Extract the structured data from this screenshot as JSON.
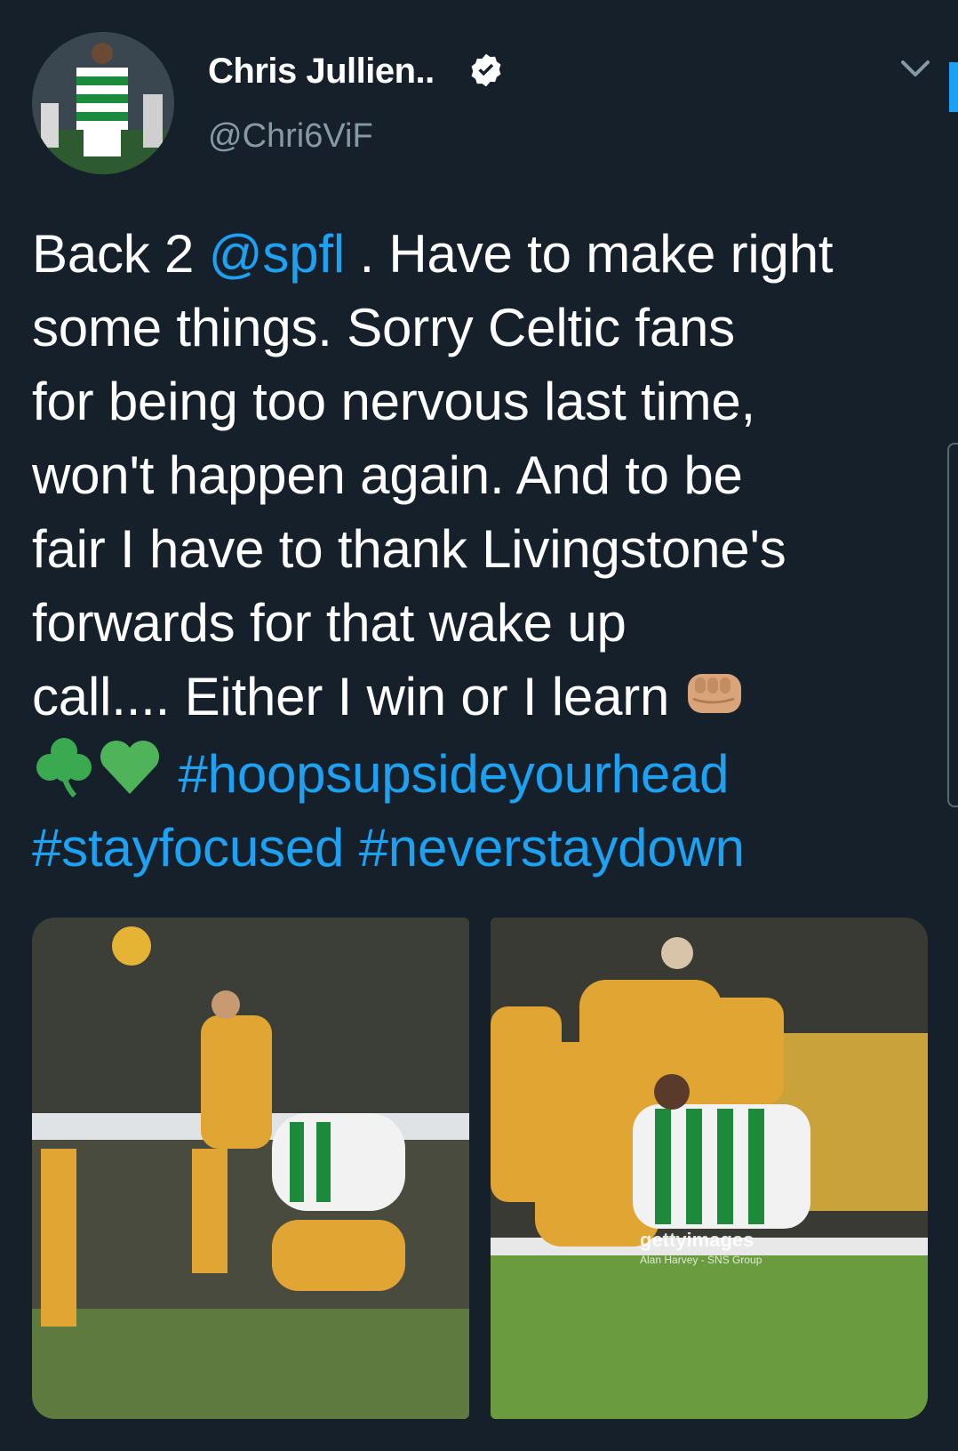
{
  "tweet": {
    "display_name": "Chris Jullien..",
    "handle": "@Chri6ViF",
    "lines": [
      {
        "parts": [
          {
            "t": "Back 2 "
          },
          {
            "t": "@spfl",
            "link": true
          },
          {
            "t": " . Have to make right"
          }
        ]
      },
      {
        "parts": [
          {
            "t": "some things. Sorry Celtic fans"
          }
        ]
      },
      {
        "parts": [
          {
            "t": "for being too nervous last time,"
          }
        ]
      },
      {
        "parts": [
          {
            "t": "won't happen again. And to be"
          }
        ]
      },
      {
        "parts": [
          {
            "t": "fair I have to thank Livingstone's"
          }
        ]
      },
      {
        "parts": [
          {
            "t": "forwards for that wake up"
          }
        ]
      },
      {
        "parts": [
          {
            "t": "call.... Either I win or I learn "
          }
        ]
      },
      {
        "parts": [
          {
            "t": " "
          },
          {
            "t": "#hoopsupsideyourhead",
            "link": true
          }
        ]
      },
      {
        "parts": [
          {
            "t": "#stayfocused",
            "link": true
          },
          {
            "t": " "
          },
          {
            "t": "#neverstaydown",
            "link": true
          }
        ]
      }
    ],
    "emojis": [
      "fist-emoji",
      "shamrock-emoji",
      "green-heart-emoji"
    ]
  },
  "media": {
    "watermark": "gettyimages",
    "credit": "Alan Harvey - SNS Group"
  },
  "colors": {
    "background": "#15202b",
    "link": "#1da1f2",
    "secondary_text": "#8899a6"
  },
  "icons": [
    "verified-badge-icon",
    "chevron-down-icon"
  ]
}
